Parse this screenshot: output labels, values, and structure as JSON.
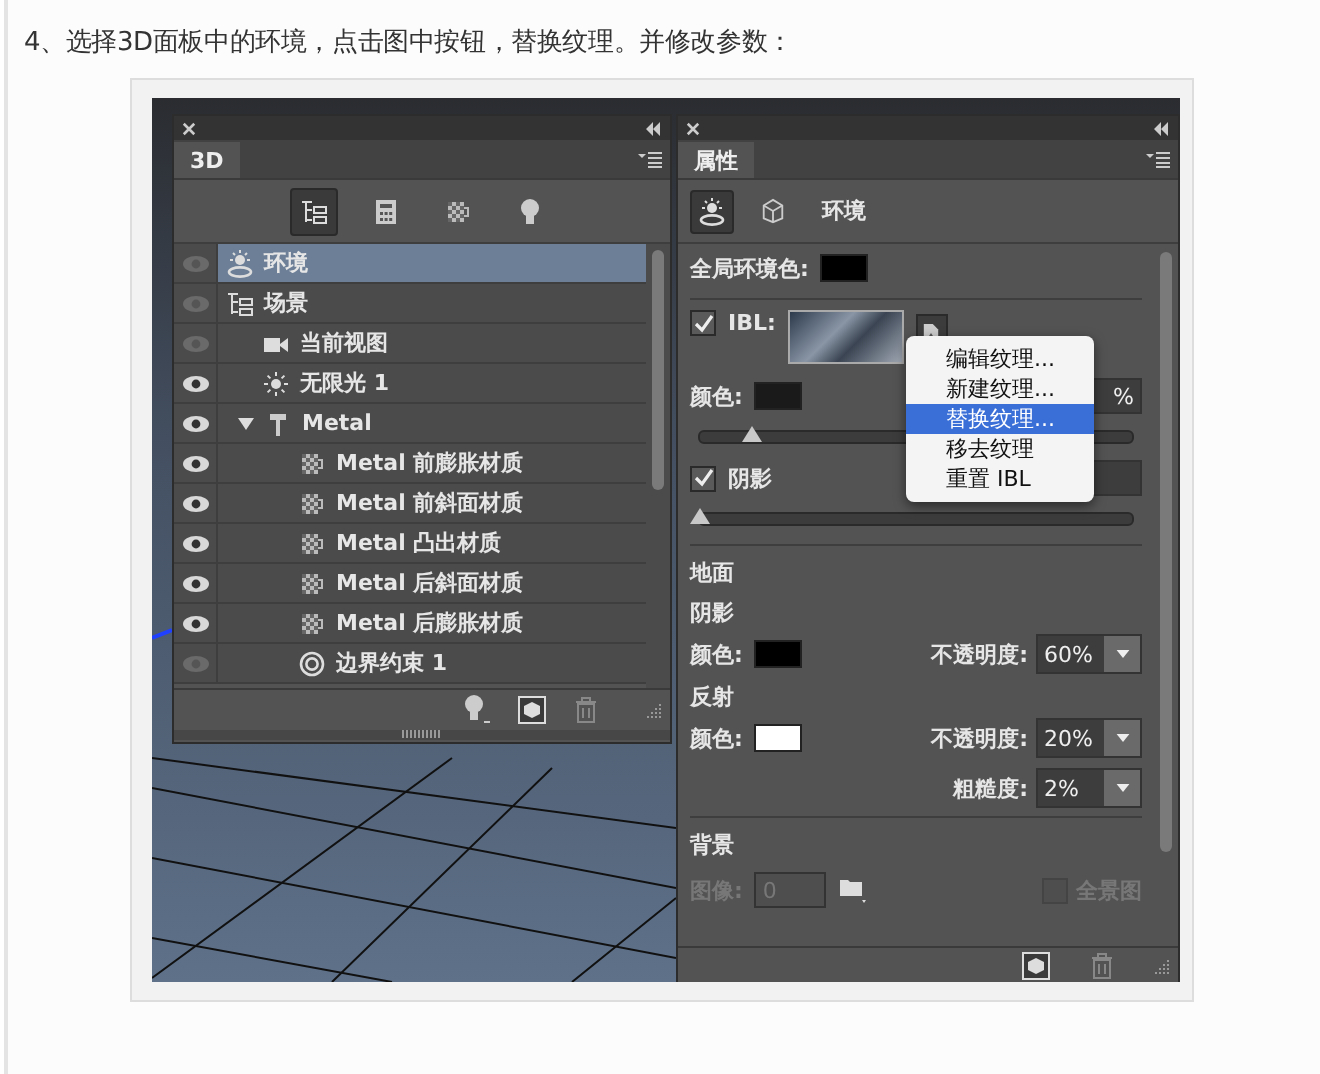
{
  "instruction": "4、选择3D面板中的环境，点击图中按钮，替换纹理。并修改参数：",
  "panel_3d": {
    "tab": {
      "label": "3D",
      "selected": true
    },
    "filters": [
      {
        "kind": "scene",
        "selected": true
      },
      {
        "kind": "mesh",
        "selected": false
      },
      {
        "kind": "material",
        "selected": false
      },
      {
        "kind": "light",
        "selected": false
      }
    ],
    "layers": [
      {
        "label": "环境",
        "kind": "environment",
        "visible": false,
        "selected": true
      },
      {
        "label": "场景",
        "kind": "scene",
        "visible": false,
        "selected": false,
        "children": [
          {
            "label": "当前视图",
            "kind": "camera",
            "visible": false,
            "selected": false
          },
          {
            "label": "无限光 1",
            "kind": "light",
            "visible": true,
            "selected": false
          },
          {
            "label": "Metal",
            "kind": "mesh",
            "visible": true,
            "selected": false,
            "expanded": true,
            "children": [
              {
                "label": "Metal 前膨胀材质",
                "kind": "material",
                "visible": true,
                "selected": false
              },
              {
                "label": "Metal 前斜面材质",
                "kind": "material",
                "visible": true,
                "selected": false
              },
              {
                "label": "Metal 凸出材质",
                "kind": "material",
                "visible": true,
                "selected": false
              },
              {
                "label": "Metal 后斜面材质",
                "kind": "material",
                "visible": true,
                "selected": false
              },
              {
                "label": "Metal 后膨胀材质",
                "kind": "material",
                "visible": true,
                "selected": false
              },
              {
                "label": "边界约束 1",
                "kind": "constraint",
                "visible": false,
                "selected": false
              }
            ]
          }
        ]
      }
    ]
  },
  "properties": {
    "tab": {
      "label": "属性",
      "selected": true
    },
    "modes": [
      {
        "kind": "environment",
        "selected": true
      },
      {
        "kind": "mesh",
        "selected": false
      }
    ],
    "heading": "环境",
    "global_ambient": {
      "label": "全局环境色:",
      "color": "#000000"
    },
    "ibl": {
      "label": "IBL:",
      "checked": true
    },
    "ibl_color": {
      "label": "颜色:",
      "color": "#1a1a1a",
      "value": "%",
      "level": 0.12
    },
    "shadows": {
      "label": "阴影",
      "checked": true,
      "level": 0.0
    },
    "ground": {
      "title": "地面",
      "shadow_title": "阴影",
      "shadow_color": {
        "label": "颜色:",
        "color": "#000000"
      },
      "shadow_opacity_label": "不透明度:",
      "shadow_opacity": "60%",
      "reflection_title": "反射",
      "reflection_color": {
        "label": "颜色:",
        "color": "#ffffff"
      },
      "reflection_opacity_label": "不透明度:",
      "reflection_opacity": "20%",
      "roughness_label": "粗糙度:",
      "roughness": "2%"
    },
    "background": {
      "title": "背景",
      "image_label": "图像:",
      "image_value": "0",
      "disabled": true,
      "panorama_label": "全景图",
      "panorama_checked": false
    }
  },
  "context_menu": [
    {
      "label": "编辑纹理...",
      "selected": false
    },
    {
      "label": "新建纹理...",
      "selected": false
    },
    {
      "label": "替换纹理...",
      "selected": true
    },
    {
      "label": "移去纹理",
      "selected": false
    },
    {
      "label": "重置 IBL",
      "selected": false
    }
  ]
}
